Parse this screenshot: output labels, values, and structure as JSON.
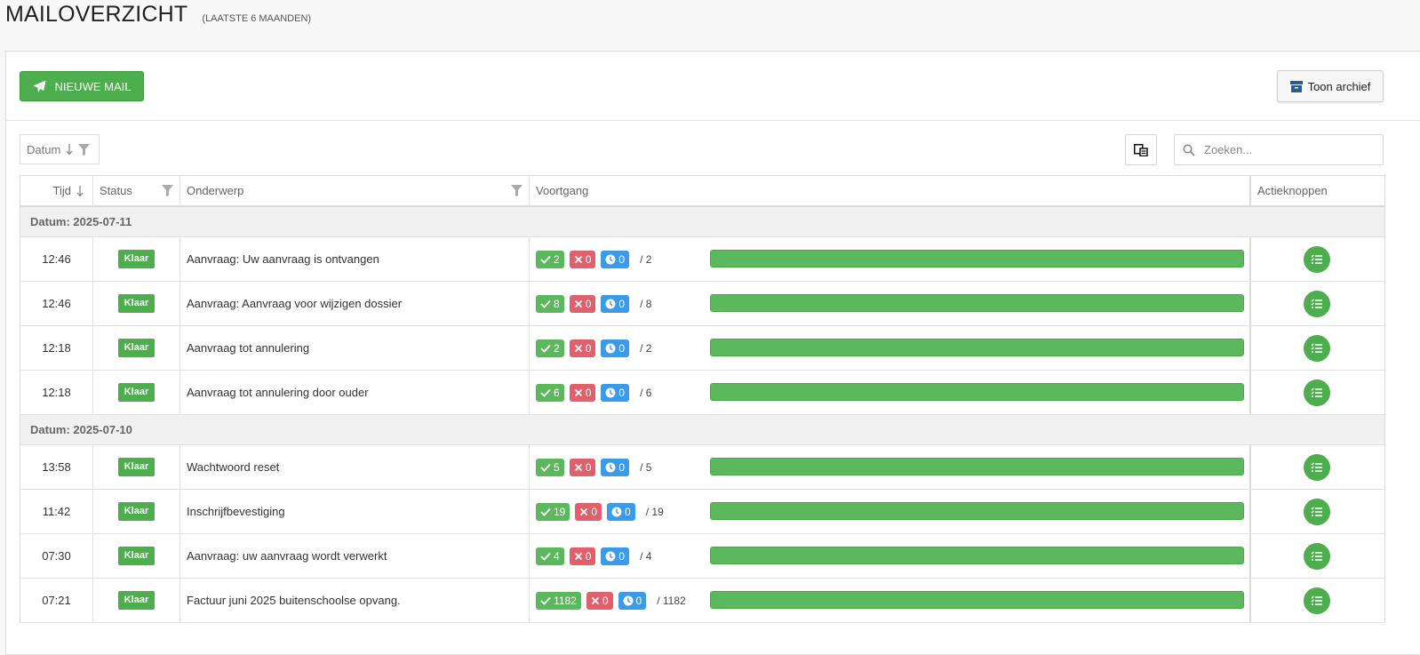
{
  "header": {
    "title": "MAILOVERZICHT",
    "subtitle": "(LAATSTE 6 MAANDEN)"
  },
  "toolbar": {
    "new_mail_label": "NIEUWE MAIL",
    "archive_label": "Toon archief"
  },
  "sort": {
    "label": "Datum"
  },
  "search": {
    "placeholder": "Zoeken..."
  },
  "columns": {
    "time": "Tijd",
    "status": "Status",
    "subject": "Onderwerp",
    "progress": "Voortgang",
    "actions": "Actieknoppen"
  },
  "colors": {
    "success": "#5cb85c",
    "danger": "#e0616b",
    "info": "#3a9be8",
    "archive_icon": "#2a5d8f"
  },
  "groups": [
    {
      "label": "Datum: 2025-07-11",
      "rows": [
        {
          "time": "12:46",
          "status": "Klaar",
          "subject": "Aanvraag: Uw aanvraag is ontvangen",
          "ok": "2",
          "err": "0",
          "wait": "0",
          "total": "/ 2",
          "progress": 1.0
        },
        {
          "time": "12:46",
          "status": "Klaar",
          "subject": "Aanvraag: Aanvraag voor wijzigen dossier",
          "ok": "8",
          "err": "0",
          "wait": "0",
          "total": "/ 8",
          "progress": 1.0
        },
        {
          "time": "12:18",
          "status": "Klaar",
          "subject": "Aanvraag tot annulering",
          "ok": "2",
          "err": "0",
          "wait": "0",
          "total": "/ 2",
          "progress": 1.0
        },
        {
          "time": "12:18",
          "status": "Klaar",
          "subject": "Aanvraag tot annulering door ouder",
          "ok": "6",
          "err": "0",
          "wait": "0",
          "total": "/ 6",
          "progress": 1.0
        }
      ]
    },
    {
      "label": "Datum: 2025-07-10",
      "rows": [
        {
          "time": "13:58",
          "status": "Klaar",
          "subject": "Wachtwoord reset",
          "ok": "5",
          "err": "0",
          "wait": "0",
          "total": "/ 5",
          "progress": 1.0
        },
        {
          "time": "11:42",
          "status": "Klaar",
          "subject": "Inschrijfbevestiging",
          "ok": "19",
          "err": "0",
          "wait": "0",
          "total": "/ 19",
          "progress": 1.0
        },
        {
          "time": "07:30",
          "status": "Klaar",
          "subject": "Aanvraag: uw aanvraag wordt verwerkt",
          "ok": "4",
          "err": "0",
          "wait": "0",
          "total": "/ 4",
          "progress": 1.0
        },
        {
          "time": "07:21",
          "status": "Klaar",
          "subject": "Factuur juni 2025 buitenschoolse opvang.",
          "ok": "1182",
          "err": "0",
          "wait": "0",
          "total": "/ 1182",
          "progress": 1.0
        }
      ]
    }
  ]
}
